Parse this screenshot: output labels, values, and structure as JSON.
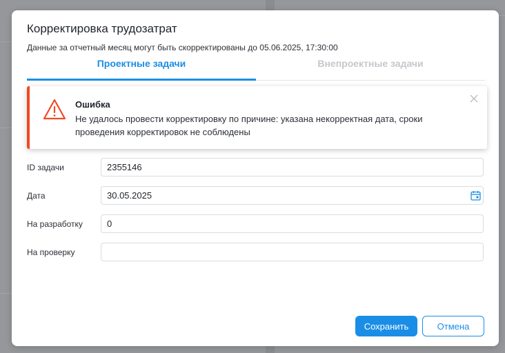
{
  "modal": {
    "title": "Корректировка трудозатрат",
    "subtitle": "Данные за отчетный месяц могут быть скорректированы до 05.06.2025, 17:30:00"
  },
  "tabs": [
    {
      "label": "Проектные задачи",
      "active": true
    },
    {
      "label": "Внепроектные задачи",
      "active": false
    }
  ],
  "alert": {
    "title": "Ошибка",
    "message": "Не удалось провести корректировку по причине: указана некорректная дата, сроки проведения корректировок не соблюдены",
    "icon": "warning-icon",
    "accent_color": "#f04a23"
  },
  "form": {
    "task_id": {
      "label": "ID задачи",
      "value": "2355146"
    },
    "date": {
      "label": "Дата",
      "value": "30.05.2025"
    },
    "development": {
      "label": "На разработку",
      "value": "0"
    },
    "review": {
      "label": "На проверку",
      "value": ""
    }
  },
  "buttons": {
    "save": "Сохранить",
    "cancel": "Отмена"
  },
  "colors": {
    "accent": "#1a8ee6",
    "error": "#f04a23"
  }
}
